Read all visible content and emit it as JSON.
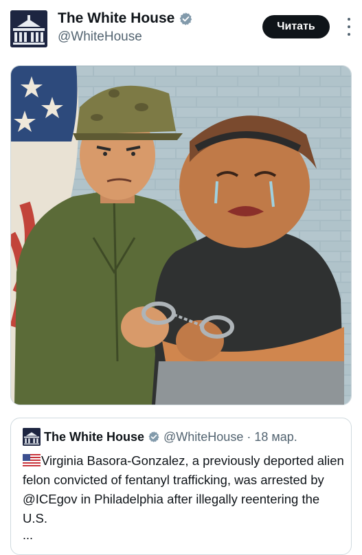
{
  "account": {
    "name": "The White House",
    "handle": "@WhiteHouse",
    "verified": true,
    "badge_color": "#829aab"
  },
  "header": {
    "read_button_label": "Читать"
  },
  "media": {
    "type": "illustration"
  },
  "quoted_post": {
    "author_name": "The White House",
    "author_handle": "@WhiteHouse",
    "separator": "·",
    "date": "18 мар.",
    "text": "Virginia Basora-Gonzalez, a previously deported alien felon convicted of fentanyl trafficking, was arrested by @ICEgov in Philadelphia after illegally reentering the U.S.",
    "ellipsis": "...",
    "flag_icon": "us-flag-icon"
  },
  "colors": {
    "text_primary": "#0f1419",
    "text_secondary": "#536471",
    "button_bg": "#0f1419",
    "border": "#cfd9de"
  }
}
